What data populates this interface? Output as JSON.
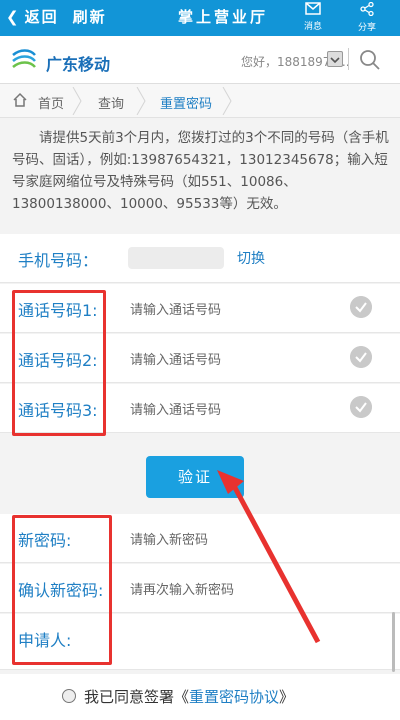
{
  "topbar": {
    "back": "返回",
    "refresh": "刷新",
    "title": "掌上营业厅",
    "messages": "消息",
    "share": "分享"
  },
  "header": {
    "brand": "广东移动",
    "greeting": "您好，18818979..."
  },
  "breadcrumb": {
    "home": "首页",
    "query": "查询",
    "current": "重置密码"
  },
  "notice": "请提供5天前3个月内，您拨打过的3个不同的号码（含手机号码、固话），例如:13987654321，13012345678；输入短号家庭网缩位号及特殊号码（如551、10086、13800138000、10000、95533等）无效。",
  "form": {
    "phone_label": "手机号码：",
    "switch": "切换",
    "call1_label": "通话号码1:",
    "call2_label": "通话号码2:",
    "call3_label": "通话号码3:",
    "call_placeholder": "请输入通话号码",
    "verify": "验证",
    "new_pwd_label": "新密码:",
    "new_pwd_placeholder": "请输入新密码",
    "confirm_label": "确认新密码:",
    "confirm_placeholder": "请再次输入新密码",
    "applicant_label": "申请人:"
  },
  "agree": {
    "text": "我已同意签署《",
    "link": "重置密码协议",
    "end": "》"
  },
  "colors": {
    "primary": "#1295d7",
    "annotation": "#e8322f"
  }
}
